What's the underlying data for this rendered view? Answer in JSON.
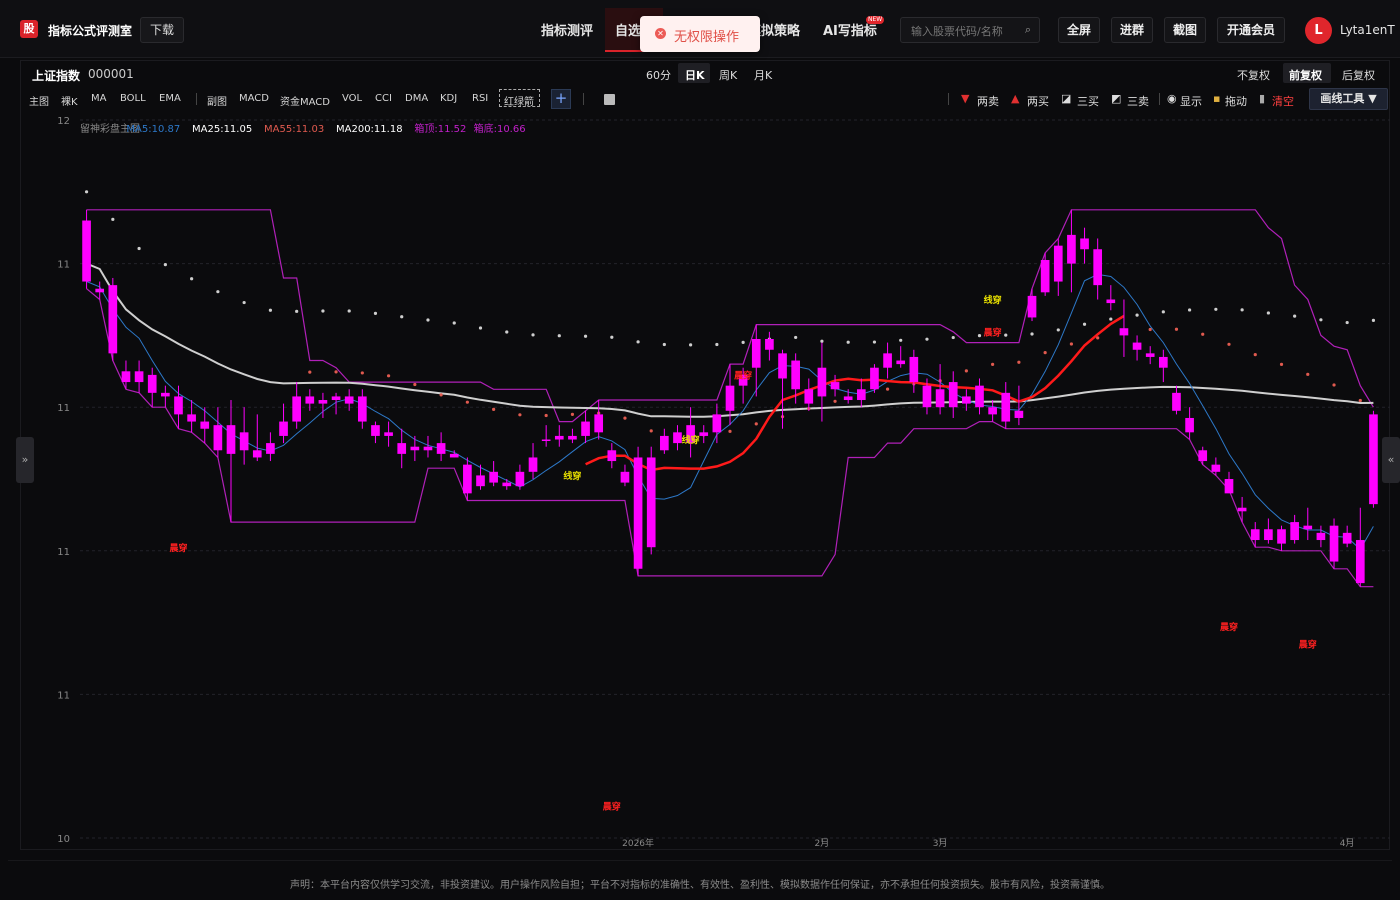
{
  "header": {
    "logo_char": "股",
    "app_title": "指标公式评测室",
    "download_label": "下载",
    "nav": [
      "指标测评",
      "自选",
      "模拟策略",
      "AI写指标"
    ],
    "new_badge": "NEW",
    "search_placeholder": "输入股票代码/名称",
    "buttons": [
      "全屏",
      "进群",
      "截图",
      "开通会员"
    ],
    "avatar_letter": "L",
    "username": "Lyta1enT"
  },
  "toast": {
    "message": "无权限操作"
  },
  "symbol": {
    "name": "上证指数",
    "code": "000001"
  },
  "periods": [
    "60分",
    "日K",
    "周K",
    "月K"
  ],
  "active_period": "日K",
  "adjust": [
    "不复权",
    "前复权",
    "后复权"
  ],
  "active_adjust": "前复权",
  "indicator_tabs": [
    "主图",
    "裸K",
    "MA",
    "BOLL",
    "EMA",
    "副图",
    "MACD",
    "资金MACD",
    "VOL",
    "CCI",
    "DMA",
    "KDJ",
    "RSI",
    "红绿箭"
  ],
  "draw_tools": {
    "two_sell": "两卖",
    "two_buy": "两买",
    "three_buy": "三买",
    "three_sell": "三卖",
    "show": "显示",
    "drag": "拖动",
    "clear": "清空",
    "draw_tool_button": "画线工具"
  },
  "colors": {
    "bg": "#0b0b0d",
    "candle": "#ff00ff",
    "accent": "#d9232a",
    "ma5": "#2d78c8",
    "ma200": "#cfcfcf",
    "ma55": "#e05a4f",
    "upper": "#b020b8"
  },
  "chart_data": {
    "type": "candlestick",
    "legend": [
      {
        "label": "留神彩盘主图",
        "color": "#888888"
      },
      {
        "label": "MA5:10.87",
        "color": "#2d78c8"
      },
      {
        "label": "MA25:11.05",
        "color": "#ffffff"
      },
      {
        "label": "MA55:11.03",
        "color": "#e05a4f"
      },
      {
        "label": "MA200:11.18",
        "color": "#ffffff"
      },
      {
        "label": "箱顶:11.52",
        "color": "#c020c8"
      },
      {
        "label": "箱底:10.66",
        "color": "#c020c8"
      }
    ],
    "y_ticks": [
      "12",
      "11",
      "11",
      "11",
      "11",
      "10"
    ],
    "x_ticks": [
      "2026年",
      "2月",
      "3月",
      "4月"
    ],
    "annotations": [
      {
        "text": "晨穿",
        "i": 7,
        "y": 10.8,
        "color": "#ff2020"
      },
      {
        "text": "晨穿",
        "i": 40,
        "y": 10.08,
        "color": "#ff2020"
      },
      {
        "text": "线穿",
        "i": 37,
        "y": 11.0,
        "color": "#e8e000"
      },
      {
        "text": "线穿",
        "i": 46,
        "y": 11.1,
        "color": "#e8e000"
      },
      {
        "text": "晨穿",
        "i": 50,
        "y": 11.28,
        "color": "#ff2020"
      },
      {
        "text": "晨穿",
        "i": 69,
        "y": 11.4,
        "color": "#ff2020"
      },
      {
        "text": "线穿",
        "i": 69,
        "y": 11.49,
        "color": "#e8e000"
      },
      {
        "text": "晨穿",
        "i": 87,
        "y": 10.58,
        "color": "#ff2020"
      },
      {
        "text": "晨穿",
        "i": 93,
        "y": 10.53,
        "color": "#ff2020"
      }
    ],
    "candles": [
      [
        11.72,
        11.55,
        11.75,
        11.53
      ],
      [
        11.53,
        11.52,
        11.55,
        11.5
      ],
      [
        11.54,
        11.35,
        11.56,
        11.33
      ],
      [
        11.3,
        11.27,
        11.33,
        11.25
      ],
      [
        11.3,
        11.27,
        11.33,
        11.24
      ],
      [
        11.29,
        11.24,
        11.31,
        11.2
      ],
      [
        11.24,
        11.23,
        11.26,
        11.2
      ],
      [
        11.23,
        11.18,
        11.26,
        11.14
      ],
      [
        11.18,
        11.16,
        11.22,
        11.13
      ],
      [
        11.16,
        11.14,
        11.2,
        11.1
      ],
      [
        11.15,
        11.08,
        11.2,
        11.06
      ],
      [
        11.15,
        11.07,
        11.22,
        10.88
      ],
      [
        11.13,
        11.08,
        11.2,
        11.04
      ],
      [
        11.08,
        11.06,
        11.18,
        11.05
      ],
      [
        11.07,
        11.1,
        11.13,
        11.05
      ],
      [
        11.12,
        11.16,
        11.21,
        11.1
      ],
      [
        11.16,
        11.23,
        11.27,
        11.14
      ],
      [
        11.21,
        11.23,
        11.25,
        11.19
      ],
      [
        11.21,
        11.22,
        11.24,
        11.17
      ],
      [
        11.22,
        11.23,
        11.24,
        11.18
      ],
      [
        11.23,
        11.21,
        11.25,
        11.19
      ],
      [
        11.23,
        11.16,
        11.25,
        11.14
      ],
      [
        11.15,
        11.12,
        11.16,
        11.1
      ],
      [
        11.13,
        11.12,
        11.16,
        11.09
      ],
      [
        11.1,
        11.07,
        11.14,
        11.03
      ],
      [
        11.09,
        11.08,
        11.12,
        11.05
      ],
      [
        11.09,
        11.08,
        11.12,
        11.06
      ],
      [
        11.1,
        11.07,
        11.13,
        11.05
      ],
      [
        11.06,
        11.07,
        11.08,
        11.06
      ],
      [
        11.04,
        10.96,
        11.06,
        10.94
      ],
      [
        11.01,
        10.98,
        11.04,
        10.97
      ],
      [
        11.02,
        10.99,
        11.05,
        10.98
      ],
      [
        10.99,
        10.98,
        11.0,
        10.97
      ],
      [
        11.02,
        10.98,
        11.04,
        10.97
      ],
      [
        11.02,
        11.06,
        11.1,
        11.0
      ],
      [
        11.11,
        11.11,
        11.15,
        11.09
      ],
      [
        11.12,
        11.11,
        11.15,
        11.09
      ],
      [
        11.11,
        11.12,
        11.14,
        11.1
      ],
      [
        11.16,
        11.12,
        11.19,
        11.1
      ],
      [
        11.18,
        11.13,
        11.22,
        11.11
      ],
      [
        11.08,
        11.05,
        11.1,
        11.03
      ],
      [
        11.02,
        10.99,
        11.04,
        10.98
      ],
      [
        11.06,
        10.75,
        11.09,
        10.73
      ],
      [
        11.06,
        10.81,
        11.09,
        10.79
      ],
      [
        11.08,
        11.12,
        11.14,
        11.07
      ],
      [
        11.13,
        11.1,
        11.15,
        11.08
      ],
      [
        11.15,
        11.1,
        11.2,
        11.06
      ],
      [
        11.13,
        11.12,
        11.15,
        11.1
      ],
      [
        11.13,
        11.18,
        11.21,
        11.1
      ],
      [
        11.19,
        11.26,
        11.32,
        11.15
      ],
      [
        11.26,
        11.29,
        11.31,
        11.21
      ],
      [
        11.31,
        11.39,
        11.43,
        11.23
      ],
      [
        11.39,
        11.36,
        11.41,
        11.33
      ],
      [
        11.35,
        11.28,
        11.36,
        11.14
      ],
      [
        11.33,
        11.25,
        11.35,
        11.21
      ],
      [
        11.21,
        11.25,
        11.28,
        11.19
      ],
      [
        11.31,
        11.23,
        11.38,
        11.16
      ],
      [
        11.27,
        11.25,
        11.29,
        11.23
      ],
      [
        11.22,
        11.23,
        11.25,
        11.21
      ],
      [
        11.25,
        11.22,
        11.28,
        11.2
      ],
      [
        11.25,
        11.31,
        11.32,
        11.24
      ],
      [
        11.31,
        11.35,
        11.38,
        11.28
      ],
      [
        11.32,
        11.33,
        11.37,
        11.31
      ],
      [
        11.34,
        11.27,
        11.36,
        11.24
      ],
      [
        11.26,
        11.2,
        11.28,
        11.18
      ],
      [
        11.25,
        11.2,
        11.32,
        11.18
      ],
      [
        11.27,
        11.2,
        11.3,
        11.17
      ],
      [
        11.21,
        11.23,
        11.25,
        11.19
      ],
      [
        11.26,
        11.2,
        11.28,
        11.18
      ],
      [
        11.2,
        11.18,
        11.22,
        11.16
      ],
      [
        11.24,
        11.16,
        11.27,
        11.14
      ],
      [
        11.17,
        11.19,
        11.26,
        11.15
      ],
      [
        11.51,
        11.45,
        11.53,
        11.44
      ],
      [
        11.61,
        11.52,
        11.63,
        11.51
      ],
      [
        11.65,
        11.55,
        11.67,
        11.51
      ],
      [
        11.68,
        11.6,
        11.75,
        11.52
      ],
      [
        11.67,
        11.64,
        11.7,
        11.6
      ],
      [
        11.64,
        11.54,
        11.67,
        11.5
      ],
      [
        11.5,
        11.49,
        11.54,
        11.47
      ],
      [
        11.42,
        11.4,
        11.5,
        11.34
      ],
      [
        11.38,
        11.36,
        11.4,
        11.33
      ],
      [
        11.35,
        11.34,
        11.37,
        11.32
      ],
      [
        11.34,
        11.31,
        11.36,
        11.27
      ],
      [
        11.24,
        11.19,
        11.26,
        11.18
      ],
      [
        11.17,
        11.13,
        11.2,
        11.11
      ],
      [
        11.08,
        11.05,
        11.09,
        11.04
      ],
      [
        11.04,
        11.02,
        11.06,
        11.01
      ],
      [
        11.0,
        10.96,
        11.02,
        10.97
      ],
      [
        10.91,
        10.92,
        10.95,
        10.88
      ],
      [
        10.86,
        10.83,
        10.88,
        10.81
      ],
      [
        10.83,
        10.86,
        10.89,
        10.82
      ],
      [
        10.82,
        10.86,
        10.87,
        10.8
      ],
      [
        10.83,
        10.88,
        10.9,
        10.82
      ],
      [
        10.87,
        10.86,
        10.92,
        10.83
      ],
      [
        10.85,
        10.83,
        10.87,
        10.81
      ],
      [
        10.87,
        10.77,
        10.89,
        10.75
      ],
      [
        10.82,
        10.85,
        10.87,
        10.81
      ],
      [
        10.83,
        10.71,
        10.92,
        10.7
      ],
      [
        10.93,
        11.18,
        11.19,
        10.92
      ]
    ]
  }
}
